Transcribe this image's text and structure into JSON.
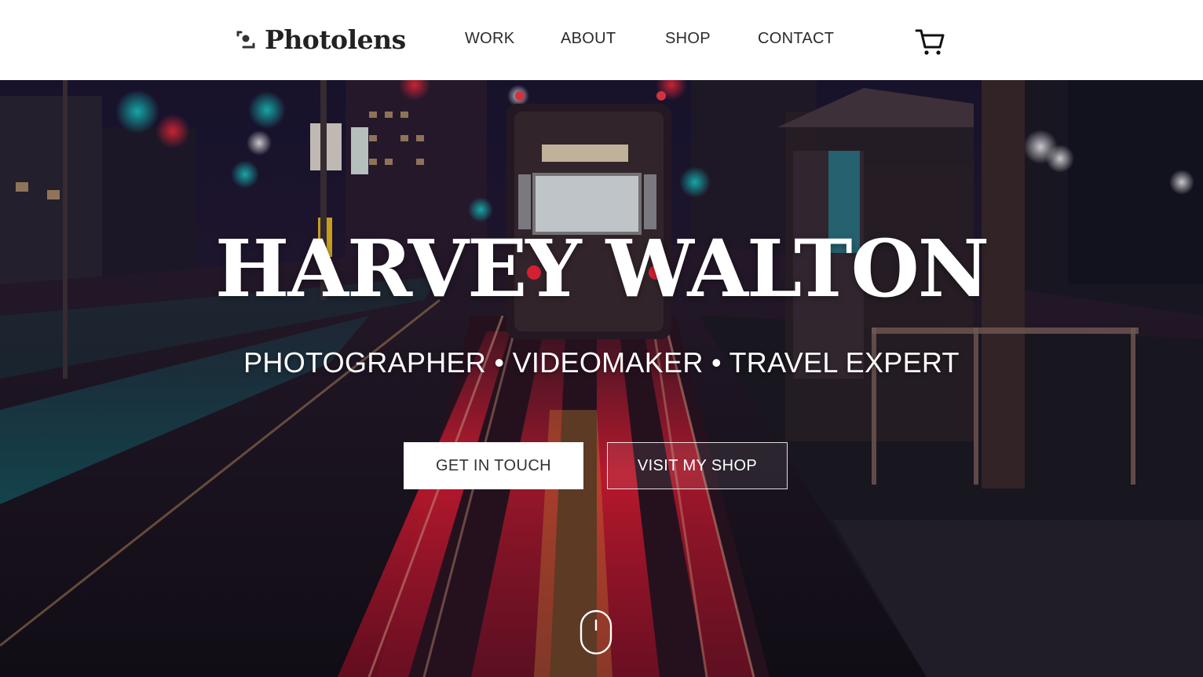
{
  "brand": {
    "name": "Photolens",
    "logo_icon": "aperture-dots-icon"
  },
  "nav": {
    "items": [
      {
        "label": "WORK"
      },
      {
        "label": "ABOUT"
      },
      {
        "label": "SHOP"
      },
      {
        "label": "CONTACT"
      }
    ],
    "cart_icon": "shopping-cart-icon"
  },
  "hero": {
    "title": "HARVEY WALTON",
    "subtitle": "PHOTOGRAPHER • VIDEOMAKER • TRAVEL EXPERT",
    "primary_button": "GET IN TOUCH",
    "secondary_button": "VISIT MY SHOP",
    "scroll_icon": "mouse-scroll-icon",
    "background_description_icon": "night-street-tram-photo"
  },
  "colors": {
    "header_bg": "#ffffff",
    "text_dark": "#222222",
    "hero_text": "#ffffff",
    "accent_red": "#e0203a",
    "accent_teal": "#17c2c2"
  }
}
